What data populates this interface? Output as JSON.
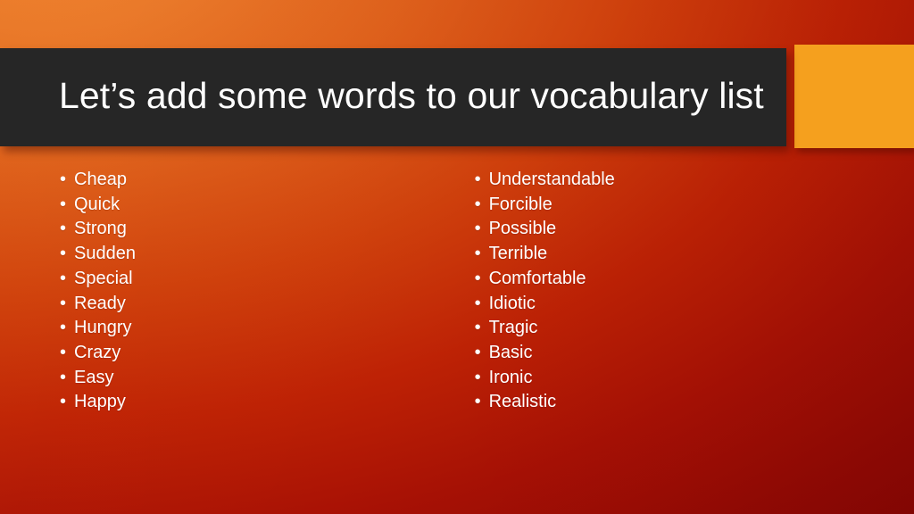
{
  "slide": {
    "title": "Let’s add some words to our vocabulary list",
    "bullet_glyph": "•",
    "colors": {
      "title_bar": "#262626",
      "accent_block": "#F5A01E",
      "text": "#FFFFFF",
      "background_top_left": "#E8772A",
      "background_mid": "#C33208",
      "background_bottom_right": "#9B0D05"
    },
    "columns": [
      {
        "name": "left-column",
        "items": [
          "Cheap",
          "Quick",
          "Strong",
          "Sudden",
          "Special",
          "Ready",
          "Hungry",
          "Crazy",
          "Easy",
          "Happy"
        ]
      },
      {
        "name": "right-column",
        "items": [
          "Understandable",
          "Forcible",
          "Possible",
          "Terrible",
          "Comfortable",
          "Idiotic",
          "Tragic",
          "Basic",
          "Ironic",
          "Realistic"
        ]
      }
    ]
  }
}
